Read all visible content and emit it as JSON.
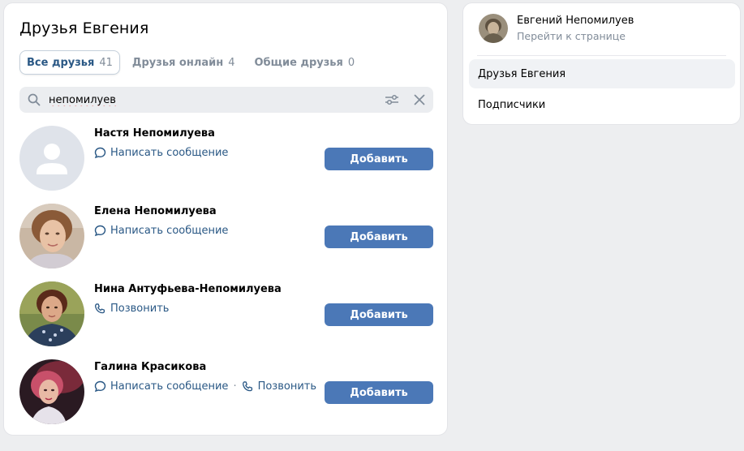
{
  "main": {
    "title": "Друзья Евгения",
    "tabs": [
      {
        "label": "Все друзья",
        "count": "41",
        "active": true
      },
      {
        "label": "Друзья онлайн",
        "count": "4",
        "active": false
      },
      {
        "label": "Общие друзья",
        "count": "0",
        "active": false
      }
    ],
    "search": {
      "value": "непомилуев",
      "placeholder": ""
    },
    "friends": [
      {
        "name": "Настя Непомилуева",
        "actions": [
          "Написать сообщение"
        ],
        "add_label": "Добавить",
        "avatar": "default"
      },
      {
        "name": "Елена Непомилуева",
        "actions": [
          "Написать сообщение"
        ],
        "add_label": "Добавить",
        "avatar": "photo"
      },
      {
        "name": "Нина Антуфьева-Непомилуева",
        "actions": [
          "Позвонить"
        ],
        "add_label": "Добавить",
        "avatar": "photo"
      },
      {
        "name": "Галина Красикова",
        "actions": [
          "Написать сообщение",
          "Позвонить"
        ],
        "add_label": "Добавить",
        "avatar": "photo"
      }
    ]
  },
  "sidebar": {
    "profile_name": "Евгений Непомилуев",
    "profile_link": "Перейти к странице",
    "menu": [
      {
        "label": "Друзья Евгения",
        "active": true
      },
      {
        "label": "Подписчики",
        "active": false
      }
    ]
  },
  "colors": {
    "accent": "#4b78b7",
    "link": "#2a5885",
    "muted": "#818c99",
    "background": "#edeef0"
  }
}
